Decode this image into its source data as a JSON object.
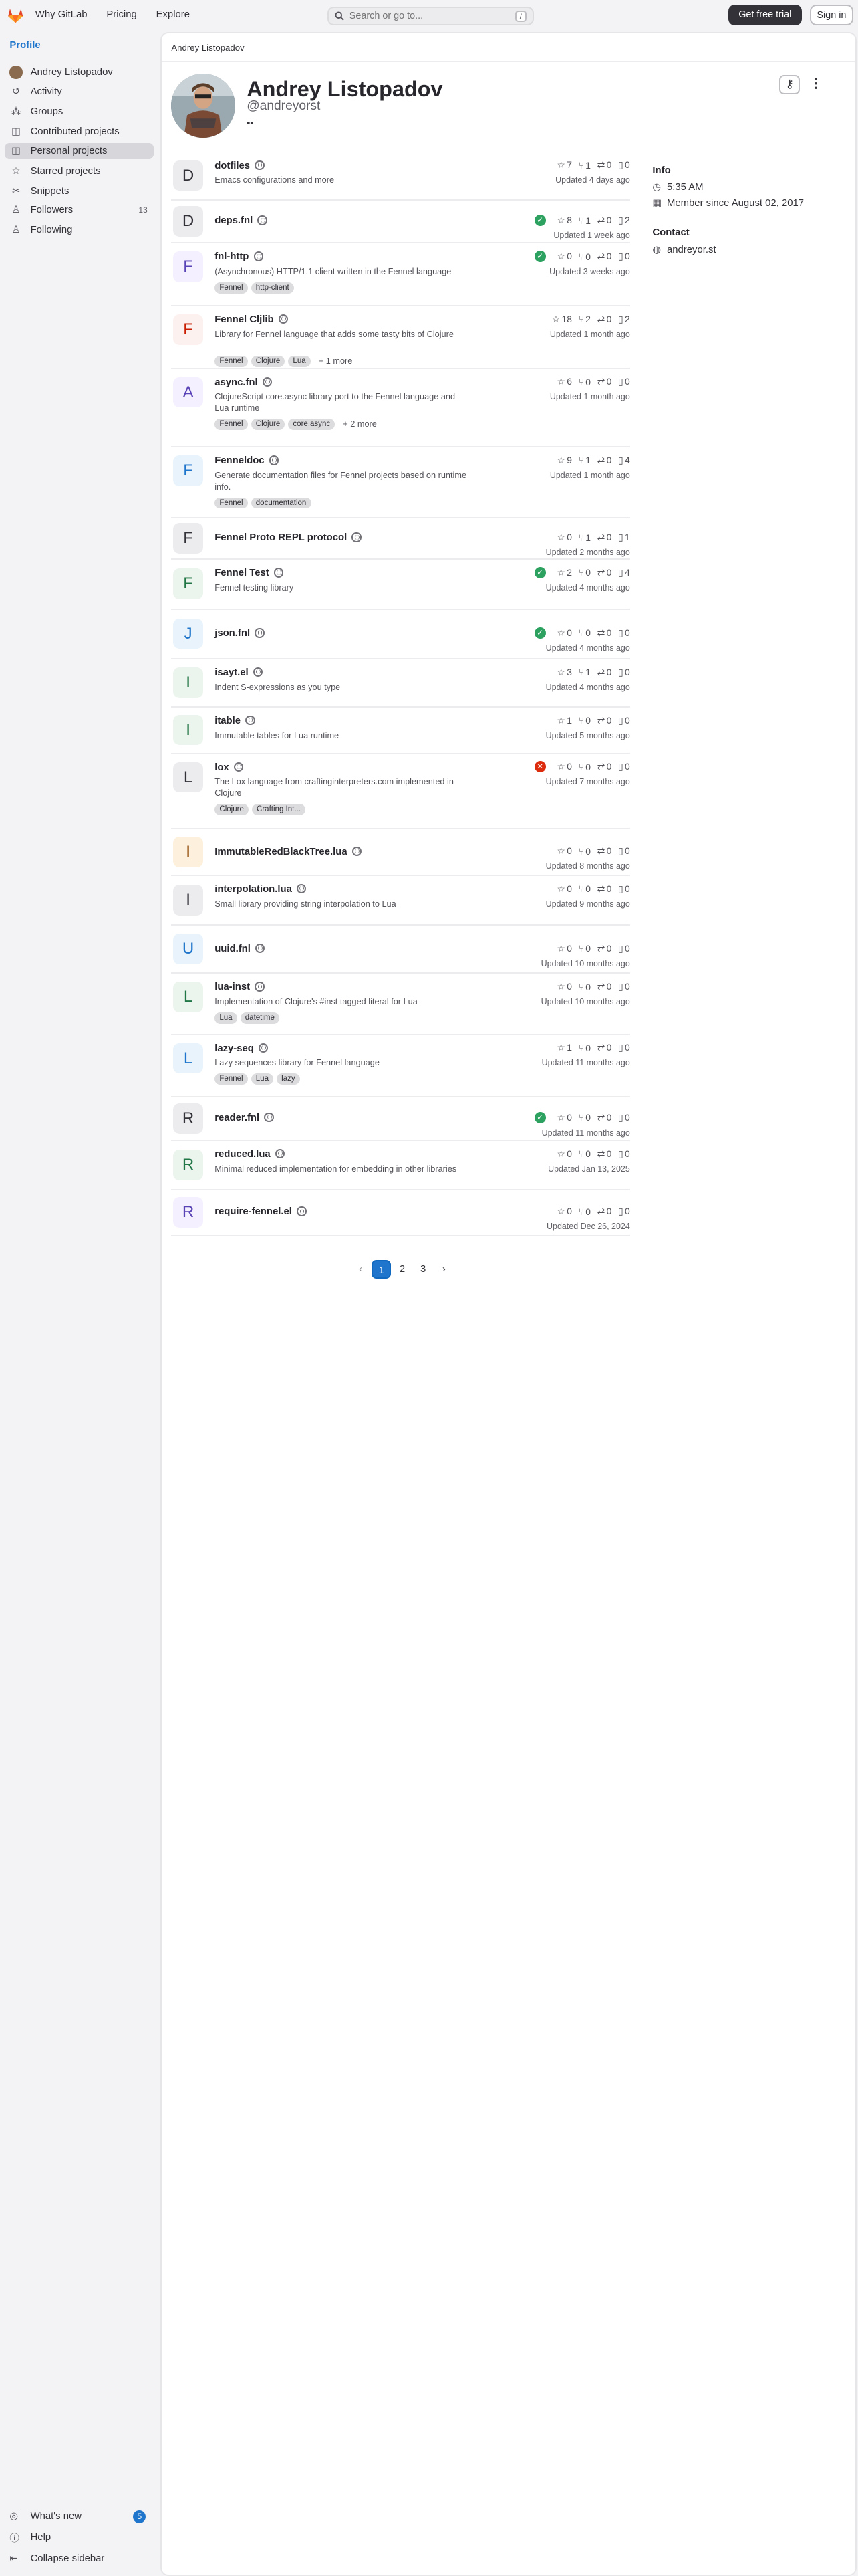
{
  "topbar": {
    "nav": [
      "Why GitLab",
      "Pricing",
      "Explore"
    ],
    "search_placeholder": "Search or go to...",
    "search_shortcut": "/",
    "trial_label": "Get free trial",
    "signin_label": "Sign in"
  },
  "sidebar": {
    "heading": "Profile",
    "items": [
      {
        "label": "Andrey Listopadov",
        "icon": "avatar"
      },
      {
        "label": "Activity",
        "icon": "activity-icon"
      },
      {
        "label": "Groups",
        "icon": "group-icon"
      },
      {
        "label": "Contributed projects",
        "icon": "project-icon"
      },
      {
        "label": "Personal projects",
        "icon": "project-icon"
      },
      {
        "label": "Starred projects",
        "icon": "star-icon"
      },
      {
        "label": "Snippets",
        "icon": "snippet-icon"
      },
      {
        "label": "Followers",
        "icon": "users-icon",
        "count": "13"
      },
      {
        "label": "Following",
        "icon": "users-icon"
      }
    ],
    "whats_new": "What's new",
    "whats_new_count": "5",
    "help": "Help",
    "collapse": "Collapse sidebar"
  },
  "breadcrumb": "Andrey Listopadov",
  "profile": {
    "name": "Andrey Listopadov",
    "username": "@andreyorst",
    "status": "••"
  },
  "info": {
    "heading": "Info",
    "time": "5:35 AM",
    "member_since": "Member since August 02, 2017",
    "contact_heading": "Contact",
    "contact": "andreyor.st"
  },
  "projects": [
    {
      "letter": "D",
      "name": "dotfiles",
      "desc": "Emacs configurations and more",
      "tags": [],
      "more": "",
      "pipe": "",
      "stars": "7",
      "forks": "1",
      "mrs": "0",
      "issues": "0",
      "updated": "Updated 4 days ago",
      "bg": "#ececef",
      "fg": "#333238"
    },
    {
      "letter": "D",
      "name": "deps.fnl",
      "desc": "",
      "tags": [],
      "more": "",
      "pipe": "ok",
      "stars": "8",
      "forks": "1",
      "mrs": "0",
      "issues": "2",
      "updated": "Updated 1 week ago",
      "bg": "#ececef",
      "fg": "#333238"
    },
    {
      "letter": "F",
      "name": "fnl-http",
      "desc": "(Asynchronous) HTTP/1.1 client written in the Fennel language",
      "tags": [
        "Fennel",
        "http-client"
      ],
      "more": "",
      "pipe": "ok",
      "stars": "0",
      "forks": "0",
      "mrs": "0",
      "issues": "0",
      "updated": "Updated 3 weeks ago",
      "bg": "#f4f0ff",
      "fg": "#5943b6"
    },
    {
      "letter": "F",
      "name": "Fennel Cljlib",
      "desc": "Library for Fennel language that adds some tasty bits of Clojure",
      "tags": [
        "Fennel",
        "Clojure",
        "Lua"
      ],
      "more": "+ 1 more",
      "pipe": "",
      "stars": "18",
      "forks": "2",
      "mrs": "0",
      "issues": "2",
      "updated": "Updated 1 month ago",
      "bg": "#fcf1ef",
      "fg": "#c91c00"
    },
    {
      "letter": "A",
      "name": "async.fnl",
      "desc": "ClojureScript core.async library port to the Fennel language and Lua runtime",
      "tags": [
        "Fennel",
        "Clojure",
        "core.async"
      ],
      "more": "+ 2 more",
      "pipe": "",
      "stars": "6",
      "forks": "0",
      "mrs": "0",
      "issues": "0",
      "updated": "Updated 1 month ago",
      "bg": "#f4f0ff",
      "fg": "#5943b6"
    },
    {
      "letter": "F",
      "name": "Fenneldoc",
      "desc": "Generate documentation files for Fennel projects based on runtime info.",
      "tags": [
        "Fennel",
        "documentation"
      ],
      "more": "",
      "pipe": "",
      "stars": "9",
      "forks": "1",
      "mrs": "0",
      "issues": "4",
      "updated": "Updated 1 month ago",
      "bg": "#e9f3fc",
      "fg": "#1f75cb"
    },
    {
      "letter": "F",
      "name": "Fennel Proto REPL protocol",
      "desc": "",
      "tags": [],
      "more": "",
      "pipe": "",
      "stars": "0",
      "forks": "1",
      "mrs": "0",
      "issues": "1",
      "updated": "Updated 2 months ago",
      "bg": "#ececef",
      "fg": "#333238"
    },
    {
      "letter": "F",
      "name": "Fennel Test",
      "desc": "Fennel testing library",
      "tags": [],
      "more": "",
      "pipe": "ok",
      "stars": "2",
      "forks": "0",
      "mrs": "0",
      "issues": "4",
      "updated": "Updated 4 months ago",
      "bg": "#ecf4ee",
      "fg": "#217645"
    },
    {
      "letter": "J",
      "name": "json.fnl",
      "desc": "",
      "tags": [],
      "more": "",
      "pipe": "ok",
      "stars": "0",
      "forks": "0",
      "mrs": "0",
      "issues": "0",
      "updated": "Updated 4 months ago",
      "bg": "#e9f3fc",
      "fg": "#1f75cb"
    },
    {
      "letter": "I",
      "name": "isayt.el",
      "desc": "Indent S-expressions as you type",
      "tags": [],
      "more": "",
      "pipe": "",
      "stars": "3",
      "forks": "1",
      "mrs": "0",
      "issues": "0",
      "updated": "Updated 4 months ago",
      "bg": "#ecf4ee",
      "fg": "#217645"
    },
    {
      "letter": "I",
      "name": "itable",
      "desc": "Immutable tables for Lua runtime",
      "tags": [],
      "more": "",
      "pipe": "",
      "stars": "1",
      "forks": "0",
      "mrs": "0",
      "issues": "0",
      "updated": "Updated 5 months ago",
      "bg": "#ecf4ee",
      "fg": "#217645"
    },
    {
      "letter": "L",
      "name": "lox",
      "desc": "The Lox language from craftinginterpreters.com implemented in Clojure",
      "tags": [
        "Clojure",
        "Crafting Int..."
      ],
      "more": "",
      "pipe": "fail",
      "stars": "0",
      "forks": "0",
      "mrs": "0",
      "issues": "0",
      "updated": "Updated 7 months ago",
      "bg": "#ececef",
      "fg": "#333238"
    },
    {
      "letter": "I",
      "name": "ImmutableRedBlackTree.lua",
      "desc": "",
      "tags": [],
      "more": "",
      "pipe": "",
      "stars": "0",
      "forks": "0",
      "mrs": "0",
      "issues": "0",
      "updated": "Updated 8 months ago",
      "bg": "#fdf1dd",
      "fg": "#8f4700"
    },
    {
      "letter": "I",
      "name": "interpolation.lua",
      "desc": "Small library providing string interpolation to Lua",
      "tags": [],
      "more": "",
      "pipe": "",
      "stars": "0",
      "forks": "0",
      "mrs": "0",
      "issues": "0",
      "updated": "Updated 9 months ago",
      "bg": "#ececef",
      "fg": "#333238"
    },
    {
      "letter": "U",
      "name": "uuid.fnl",
      "desc": "",
      "tags": [],
      "more": "",
      "pipe": "",
      "stars": "0",
      "forks": "0",
      "mrs": "0",
      "issues": "0",
      "updated": "Updated 10 months ago",
      "bg": "#e9f3fc",
      "fg": "#1f75cb"
    },
    {
      "letter": "L",
      "name": "lua-inst",
      "desc": "Implementation of Clojure's #inst tagged literal for Lua",
      "tags": [
        "Lua",
        "datetime"
      ],
      "more": "",
      "pipe": "",
      "stars": "0",
      "forks": "0",
      "mrs": "0",
      "issues": "0",
      "updated": "Updated 10 months ago",
      "bg": "#ecf4ee",
      "fg": "#217645"
    },
    {
      "letter": "L",
      "name": "lazy-seq",
      "desc": "Lazy sequences library for Fennel language",
      "tags": [
        "Fennel",
        "Lua",
        "lazy"
      ],
      "more": "",
      "pipe": "",
      "stars": "1",
      "forks": "0",
      "mrs": "0",
      "issues": "0",
      "updated": "Updated 11 months ago",
      "bg": "#e9f3fc",
      "fg": "#1f75cb"
    },
    {
      "letter": "R",
      "name": "reader.fnl",
      "desc": "",
      "tags": [],
      "more": "",
      "pipe": "ok",
      "stars": "0",
      "forks": "0",
      "mrs": "0",
      "issues": "0",
      "updated": "Updated 11 months ago",
      "bg": "#ececef",
      "fg": "#333238"
    },
    {
      "letter": "R",
      "name": "reduced.lua",
      "desc": "Minimal reduced implementation for embedding in other libraries",
      "tags": [],
      "more": "",
      "pipe": "",
      "stars": "0",
      "forks": "0",
      "mrs": "0",
      "issues": "0",
      "updated": "Updated Jan 13, 2025",
      "bg": "#ecf4ee",
      "fg": "#217645"
    },
    {
      "letter": "R",
      "name": "require-fennel.el",
      "desc": "",
      "tags": [],
      "more": "",
      "pipe": "",
      "stars": "0",
      "forks": "0",
      "mrs": "0",
      "issues": "0",
      "updated": "Updated Dec 26, 2024",
      "bg": "#f4f0ff",
      "fg": "#5943b6"
    }
  ],
  "pagination": {
    "pages": [
      "1",
      "2",
      "3"
    ],
    "current": "1"
  }
}
